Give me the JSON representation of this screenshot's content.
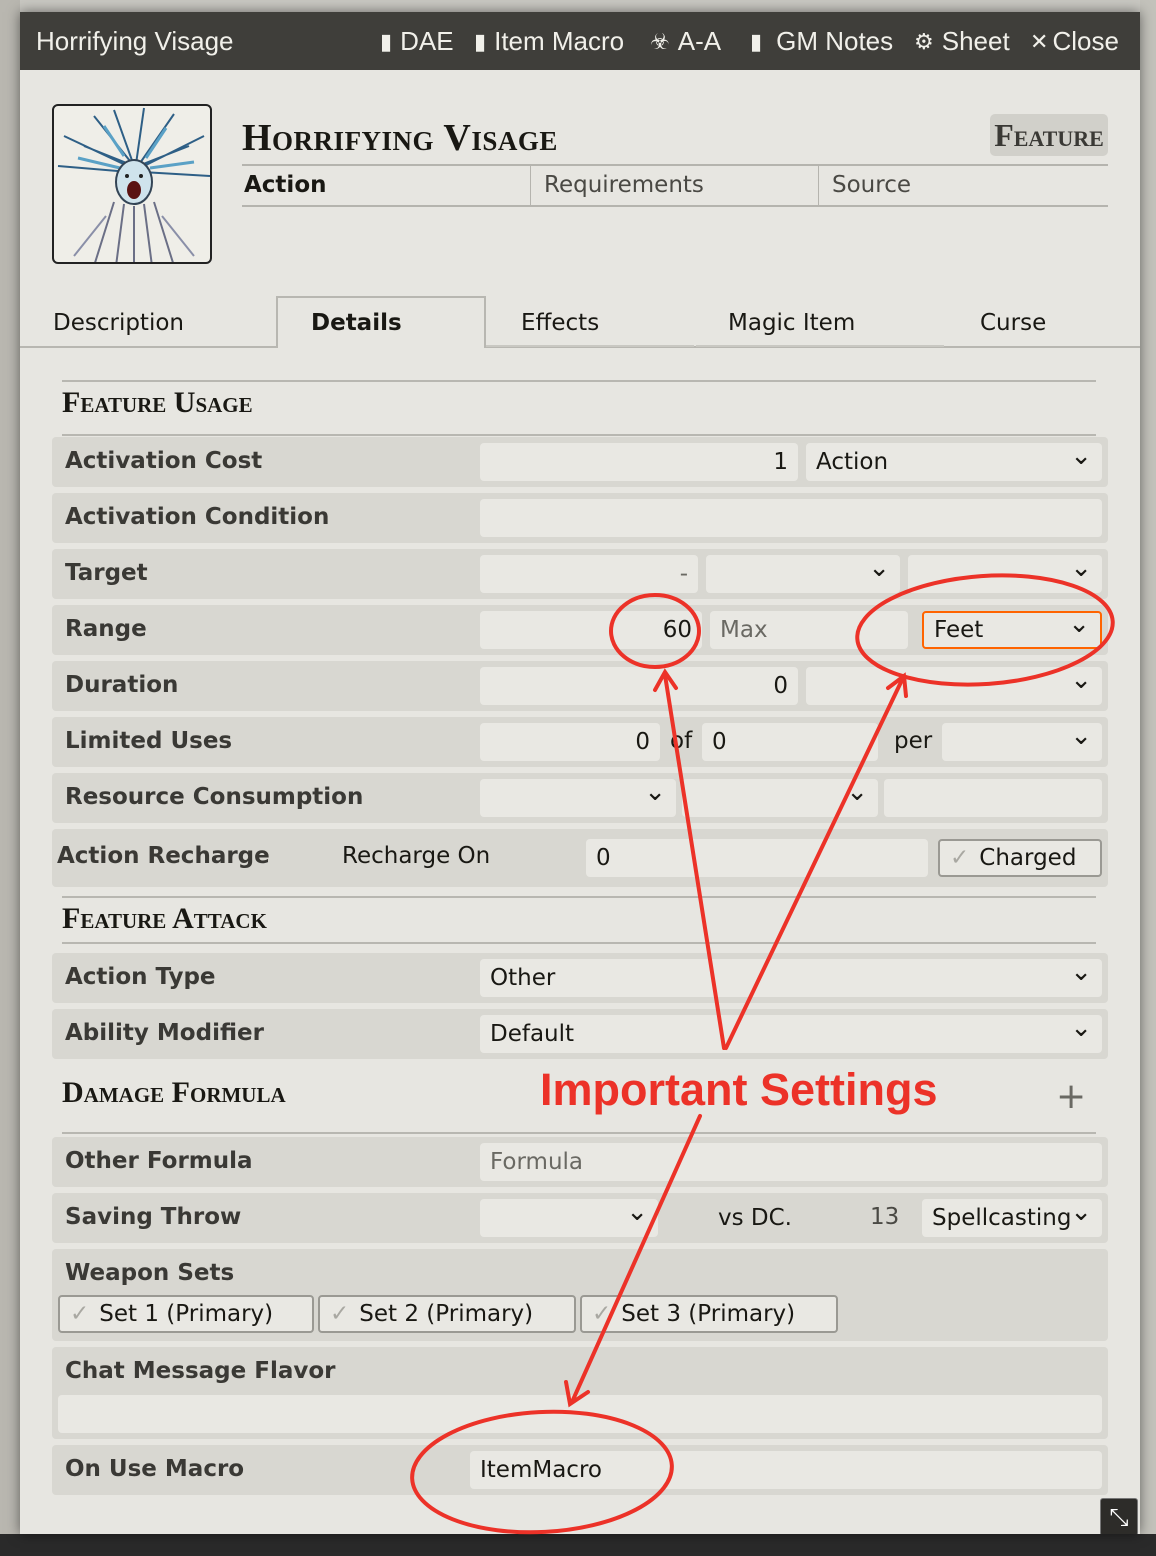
{
  "window": {
    "title": "Horrifying Visage",
    "buttons": [
      {
        "label": "DAE",
        "icon": "clipboard-icon"
      },
      {
        "label": "Item Macro",
        "icon": "file-icon"
      },
      {
        "label": "A-A",
        "icon": "biohazard-icon"
      },
      {
        "label": "GM Notes",
        "icon": "clipboard-icon"
      },
      {
        "label": "Sheet",
        "icon": "gear-icon"
      },
      {
        "label": "Close",
        "icon": "close-icon"
      }
    ]
  },
  "header": {
    "name": "Horrifying Visage",
    "type": "Feature",
    "activation": "Action",
    "requirements": "Requirements",
    "source": "Source"
  },
  "tabs": [
    "Description",
    "Details",
    "Effects",
    "Magic Item",
    "Curse"
  ],
  "active_tab": "Details",
  "sections": {
    "usage": "Feature Usage",
    "attack": "Feature Attack",
    "damage": "Damage Formula"
  },
  "fields": {
    "activation_cost": {
      "label": "Activation Cost",
      "value": "1",
      "type": "Action"
    },
    "activation_condition": {
      "label": "Activation Condition",
      "value": ""
    },
    "target": {
      "label": "Target",
      "value": "-"
    },
    "range": {
      "label": "Range",
      "value": "60",
      "max_placeholder": "Max",
      "units": "Feet"
    },
    "duration": {
      "label": "Duration",
      "value": "0"
    },
    "limited_uses": {
      "label": "Limited Uses",
      "value": "0",
      "of": "of",
      "max": "0",
      "per": "per"
    },
    "resource": {
      "label": "Resource Consumption"
    },
    "recharge": {
      "label": "Action Recharge",
      "sublabel": "Recharge On",
      "value": "0",
      "charged": "Charged"
    },
    "action_type": {
      "label": "Action Type",
      "value": "Other"
    },
    "ability_mod": {
      "label": "Ability Modifier",
      "value": "Default"
    },
    "other_formula": {
      "label": "Other Formula",
      "placeholder": "Formula"
    },
    "saving_throw": {
      "label": "Saving Throw",
      "vs": "vs DC.",
      "dc": "13",
      "scaling": "Spellcasting"
    },
    "weapon_sets": {
      "label": "Weapon Sets",
      "sets": [
        "Set 1 (Primary)",
        "Set 2 (Primary)",
        "Set 3 (Primary)"
      ]
    },
    "chat_flavor": {
      "label": "Chat Message Flavor",
      "value": ""
    },
    "on_use_macro": {
      "label": "On Use Macro",
      "value": "ItemMacro"
    }
  },
  "annotation": {
    "text": "Important Settings",
    "color": "#ec3228"
  },
  "colors": {
    "titlebar": "#3f3e3a",
    "sheet_bg": "#e7e6e1",
    "highlight_border": "#ff6400"
  }
}
